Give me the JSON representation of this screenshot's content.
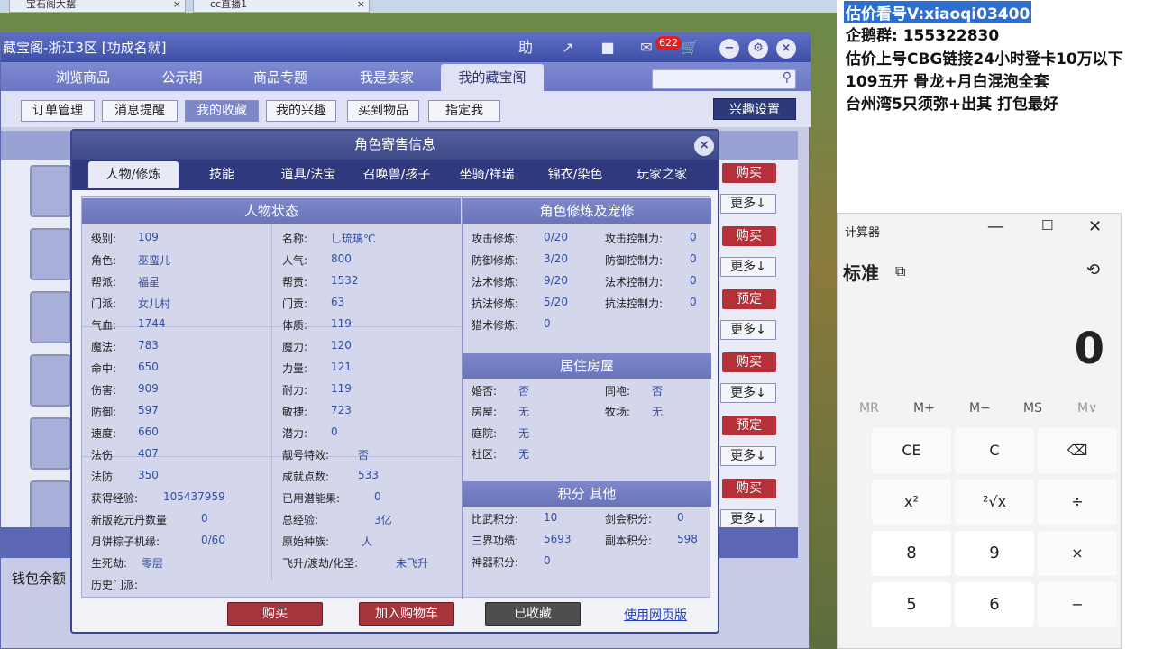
{
  "browser_tabs": [
    {
      "label": "宝石阁大摆"
    },
    {
      "label": "cc直播1"
    }
  ],
  "window": {
    "title": "藏宝阁-浙江3区 [功成名就]",
    "help_label": "助",
    "cart_count": "622"
  },
  "nav_tabs": [
    "浏览商品",
    "公示期",
    "商品专题",
    "我是卖家",
    "我的藏宝阁"
  ],
  "sub_buttons": [
    "订单管理",
    "消息提醒",
    "我的收藏",
    "我的兴趣",
    "买到物品",
    "指定我"
  ],
  "interest_label": "兴趣设置",
  "wallet_label": "钱包余额",
  "list_actions": [
    {
      "buy": "购买",
      "more": "更多↓"
    },
    {
      "buy": "购买",
      "more": "更多↓"
    },
    {
      "buy": "预定",
      "more": "更多↓"
    },
    {
      "buy": "购买",
      "more": "更多↓"
    },
    {
      "buy": "预定",
      "more": "更多↓"
    },
    {
      "buy": "购买",
      "more": "更多↓"
    }
  ],
  "dialog": {
    "title": "角色寄售信息",
    "tabs": [
      "人物/修炼",
      "技能",
      "道具/法宝",
      "召唤兽/孩子",
      "坐骑/祥瑞",
      "锦衣/染色",
      "玩家之家"
    ],
    "status_header": "人物状态",
    "left_stats": [
      {
        "label": "级别:",
        "value": "109"
      },
      {
        "label": "角色:",
        "value": "巫蛮儿"
      },
      {
        "label": "帮派:",
        "value": "福星"
      },
      {
        "label": "门派:",
        "value": "女儿村"
      },
      {
        "label": "气血:",
        "value": "1744"
      },
      {
        "label": "魔法:",
        "value": "783"
      },
      {
        "label": "命中:",
        "value": "650"
      },
      {
        "label": "伤害:",
        "value": "909"
      },
      {
        "label": "防御:",
        "value": "597"
      },
      {
        "label": "速度:",
        "value": "660"
      },
      {
        "label": "法伤",
        "value": "407"
      },
      {
        "label": "法防",
        "value": "350"
      }
    ],
    "mid_stats": [
      {
        "label": "名称:",
        "value": "乚琉璃℃"
      },
      {
        "label": "人气:",
        "value": "800"
      },
      {
        "label": "帮贡:",
        "value": "1532"
      },
      {
        "label": "门贡:",
        "value": "63"
      },
      {
        "label": "体质:",
        "value": "119"
      },
      {
        "label": "魔力:",
        "value": "120"
      },
      {
        "label": "力量:",
        "value": "121"
      },
      {
        "label": "耐力:",
        "value": "119"
      },
      {
        "label": "敏捷:",
        "value": "723"
      },
      {
        "label": "潜力:",
        "value": "0"
      },
      {
        "label": "靓号特效:",
        "value": "否"
      },
      {
        "label": "成就点数:",
        "value": "533"
      }
    ],
    "extra_stats": [
      {
        "label": "获得经验:",
        "value": "105437959",
        "label2": "已用潜能果:",
        "value2": "0"
      },
      {
        "label": "新版乾元丹数量",
        "value": "0",
        "label2": "总经验:",
        "value2": "3亿"
      },
      {
        "label": "月饼粽子机缘:",
        "value": "0/60",
        "label2": "原始种族:",
        "value2": "人"
      },
      {
        "label": "生死劫:",
        "value": "零层",
        "label2": "飞升/渡劫/化圣:",
        "value2": "未飞升"
      },
      {
        "label": "历史门派:",
        "value": "",
        "label2": "",
        "value2": ""
      }
    ],
    "cultivation_header": "角色修炼及宠修",
    "cultivation": [
      {
        "label": "攻击修炼:",
        "value": "0/20",
        "label2": "攻击控制力:",
        "value2": "0"
      },
      {
        "label": "防御修炼:",
        "value": "3/20",
        "label2": "防御控制力:",
        "value2": "0"
      },
      {
        "label": "法术修炼:",
        "value": "9/20",
        "label2": "法术控制力:",
        "value2": "0"
      },
      {
        "label": "抗法修炼:",
        "value": "5/20",
        "label2": "抗法控制力:",
        "value2": "0"
      },
      {
        "label": "猎术修炼:",
        "value": "0",
        "label2": "",
        "value2": ""
      }
    ],
    "house_header": "居住房屋",
    "house": [
      {
        "label": "婚否:",
        "value": "否",
        "label2": "同袍:",
        "value2": "否"
      },
      {
        "label": "房屋:",
        "value": "无",
        "label2": "牧场:",
        "value2": "无"
      },
      {
        "label": "庭院:",
        "value": "无",
        "label2": "",
        "value2": ""
      },
      {
        "label": "社区:",
        "value": "无",
        "label2": "",
        "value2": ""
      }
    ],
    "points_header": "积分 其他",
    "points": [
      {
        "label": "比武积分:",
        "value": "10",
        "label2": "剑会积分:",
        "value2": "0"
      },
      {
        "label": "三界功绩:",
        "value": "5693",
        "label2": "副本积分:",
        "value2": "598"
      },
      {
        "label": "神器积分:",
        "value": "0",
        "label2": "",
        "value2": ""
      }
    ],
    "buy_label": "购买",
    "cart_label": "加入购物车",
    "collected_label": "已收藏",
    "web_link": "使用网页版"
  },
  "overlay_lines": [
    "估价看号V:xiaoqi03400",
    "企鹅群: 155322830",
    "估价上号CBG链接24小时登卡10万以下",
    "109五开 骨龙+月白混泡全套",
    "台州湾5只须弥+出其 打包最好"
  ],
  "calculator": {
    "title": "计算器",
    "mode": "标准",
    "display": "0",
    "memory": [
      "MR",
      "M+",
      "M−",
      "MS",
      "M∨"
    ],
    "buttons": [
      [
        "CE",
        "C",
        "⌫"
      ],
      [
        "x²",
        "²√x",
        "÷"
      ],
      [
        "8",
        "9",
        "×"
      ],
      [
        "5",
        "6",
        "−"
      ]
    ]
  }
}
